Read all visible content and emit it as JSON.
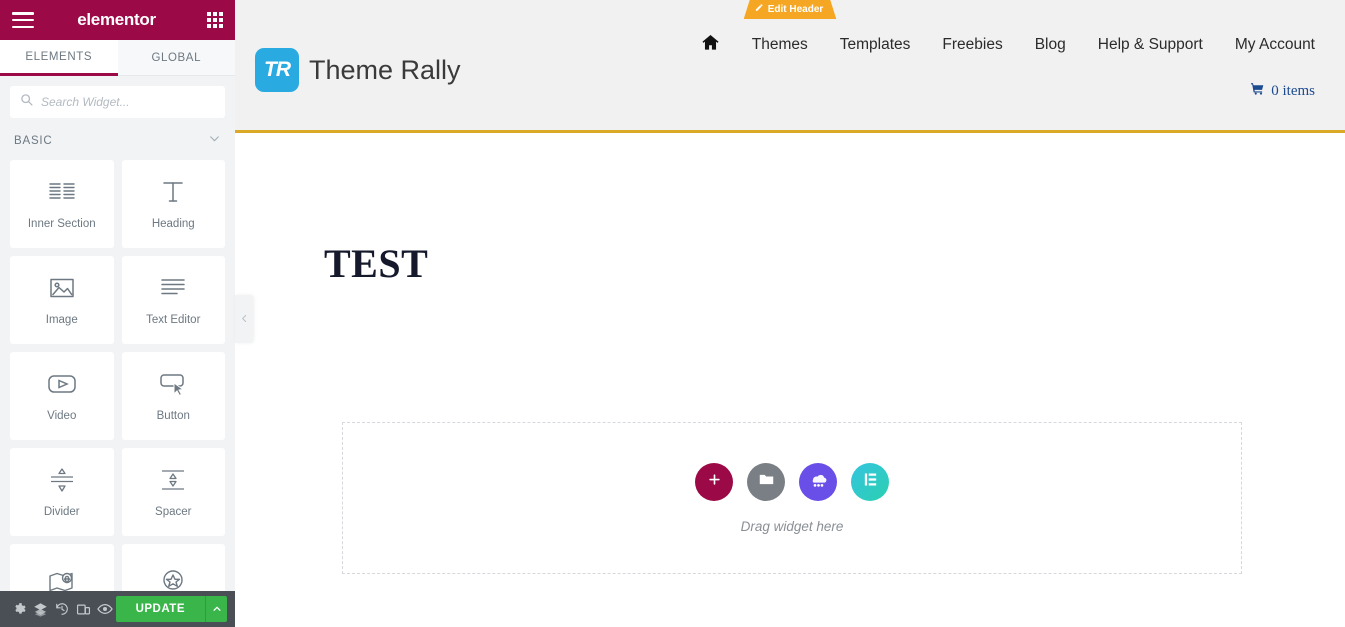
{
  "panel": {
    "brand": "elementor",
    "menu_icon": "hamburger-icon",
    "apps_icon": "grid-icon",
    "tabs": [
      {
        "label": "ELEMENTS",
        "active": true
      },
      {
        "label": "GLOBAL",
        "active": false
      }
    ],
    "search": {
      "placeholder": "Search Widget...",
      "value": "",
      "icon": "search-icon"
    },
    "category": {
      "title": "BASIC",
      "chevron": "chevron-down-icon"
    },
    "widgets": [
      {
        "label": "Inner Section",
        "icon": "inner-section-icon"
      },
      {
        "label": "Heading",
        "icon": "heading-icon"
      },
      {
        "label": "Image",
        "icon": "image-icon"
      },
      {
        "label": "Text Editor",
        "icon": "text-editor-icon"
      },
      {
        "label": "Video",
        "icon": "video-icon"
      },
      {
        "label": "Button",
        "icon": "button-icon"
      },
      {
        "label": "Divider",
        "icon": "divider-icon"
      },
      {
        "label": "Spacer",
        "icon": "spacer-icon"
      },
      {
        "label": "",
        "icon": "google-maps-icon"
      },
      {
        "label": "",
        "icon": "icon-box-icon"
      }
    ],
    "footer": {
      "icons": [
        "settings-gear-icon",
        "navigator-layers-icon",
        "history-icon",
        "responsive-mode-icon",
        "preview-eye-icon"
      ],
      "update_label": "UPDATE",
      "update_caret": "caret-up-icon",
      "update_color": "#39b54a"
    },
    "collapse_handle": "chevron-left-icon",
    "header_color": "#9b0a46"
  },
  "preview": {
    "edit_badge": {
      "label": "Edit Header",
      "icon": "pencil-icon",
      "color": "#f5a623"
    },
    "logo": {
      "mark_text": "TR",
      "mark_color": "#29abe2",
      "text": "Theme Rally"
    },
    "nav": [
      {
        "label": "",
        "icon": "home-icon"
      },
      {
        "label": "Themes",
        "icon": ""
      },
      {
        "label": "Templates",
        "icon": ""
      },
      {
        "label": "Freebies",
        "icon": ""
      },
      {
        "label": "Blog",
        "icon": ""
      },
      {
        "label": "Help & Support",
        "icon": ""
      },
      {
        "label": "My Account",
        "icon": ""
      }
    ],
    "cart": {
      "icon": "shopping-cart-icon",
      "label": "0 items",
      "color": "#1d4b8f"
    },
    "page_title": "TEST",
    "dropzone": {
      "label": "Drag widget here",
      "actions": [
        {
          "name": "add-section",
          "icon": "plus-icon",
          "color": "#9b0a46"
        },
        {
          "name": "add-folder",
          "icon": "folder-icon",
          "color": "#7a7f85"
        },
        {
          "name": "add-template",
          "icon": "template-cloud-icon",
          "color": "#6a4ee8"
        },
        {
          "name": "elementor-logo",
          "icon": "elementor-e-icon",
          "color": "#29c8c8"
        }
      ]
    }
  }
}
